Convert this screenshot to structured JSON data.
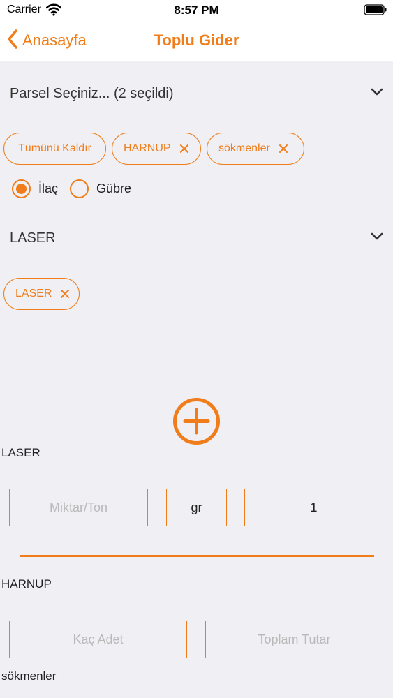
{
  "status_bar": {
    "carrier": "Carrier",
    "time": "8:57 PM"
  },
  "nav": {
    "back_label": "Anasayfa",
    "title": "Toplu Gider"
  },
  "parcel_dropdown": {
    "label": "Parsel Seçiniz... (2 seçildi)"
  },
  "parcel_chips": [
    {
      "label": "Tümünü Kaldır"
    },
    {
      "label": "HARNUP"
    },
    {
      "label": "sökmenler"
    }
  ],
  "type_radio": [
    {
      "label": "İlaç",
      "selected": true
    },
    {
      "label": "Gübre",
      "selected": false
    }
  ],
  "product_dropdown": {
    "label": "LASER"
  },
  "product_chips": [
    {
      "label": "LASER"
    }
  ],
  "sections": {
    "laser": {
      "title": "LASER",
      "quantity_placeholder": "Miktar/Ton",
      "unit": "gr",
      "count": "1"
    },
    "harnup": {
      "title": "HARNUP",
      "count_placeholder": "Kaç Adet",
      "total_placeholder": "Toplam Tutar"
    },
    "sokmenler": {
      "title": "sökmenler"
    }
  },
  "colors": {
    "accent": "#f07d19",
    "background": "#efeff4"
  }
}
